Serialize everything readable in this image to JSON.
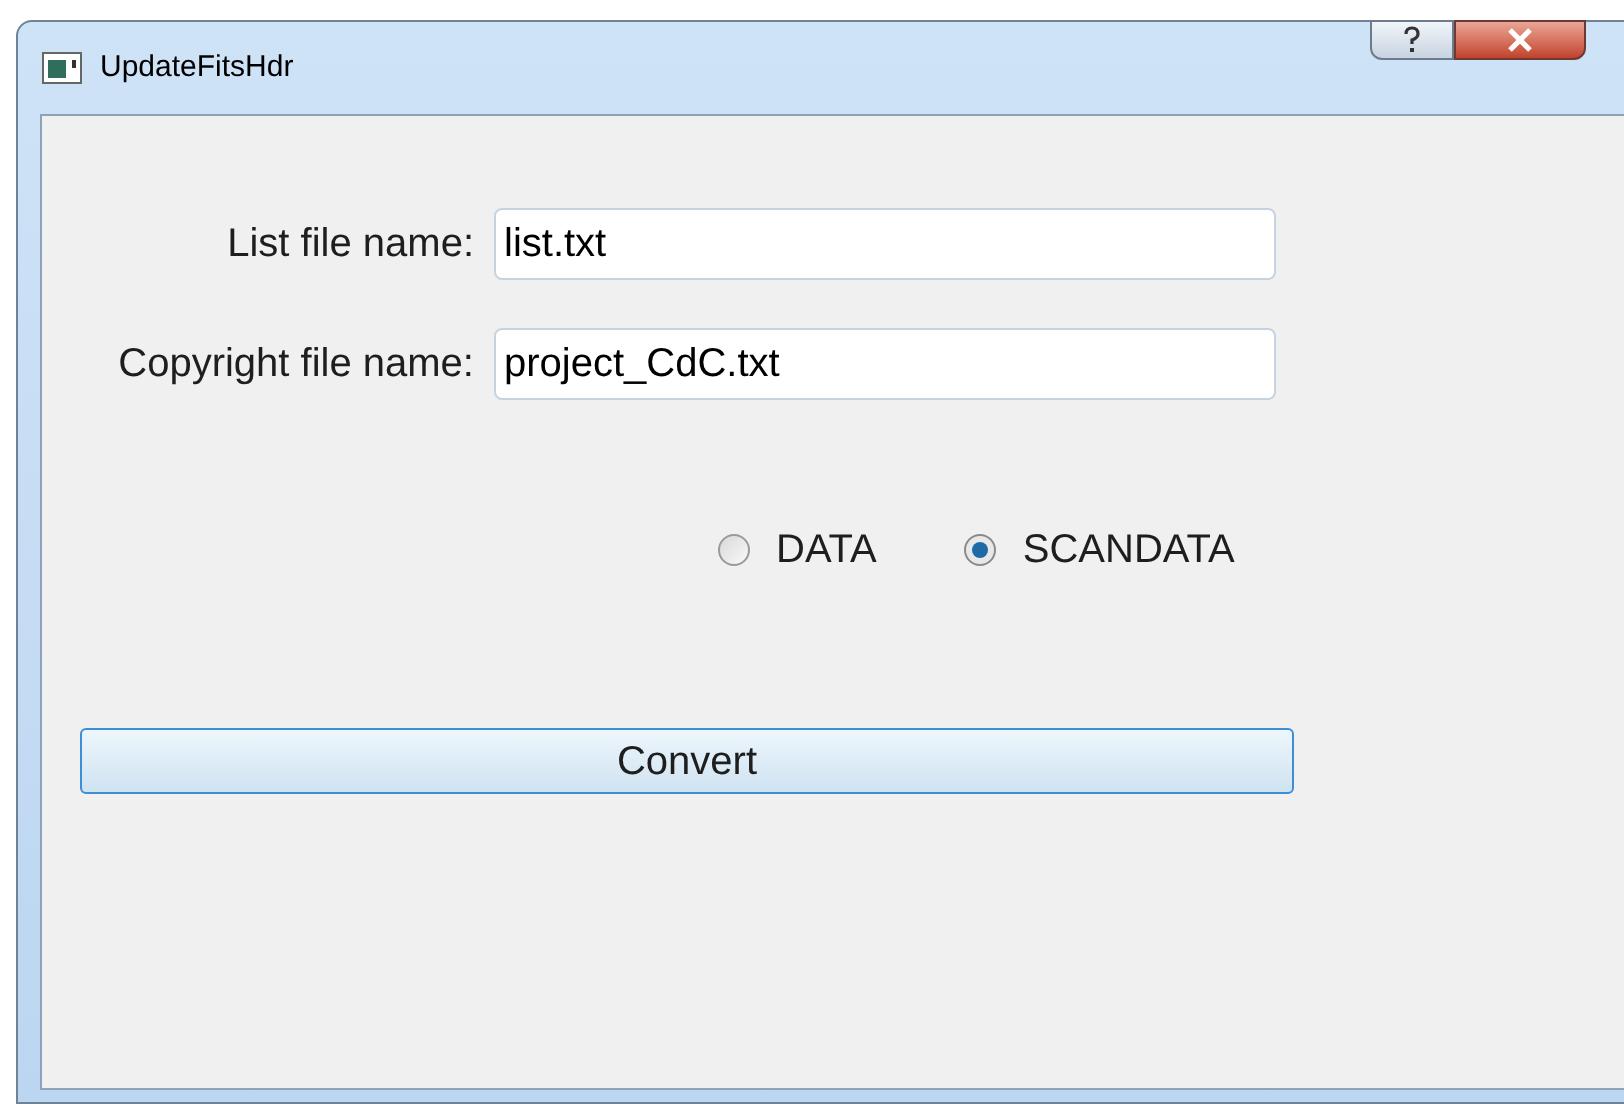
{
  "window": {
    "title": "UpdateFitsHdr"
  },
  "fields": [
    {
      "label": "List file name:",
      "value": "list.txt"
    },
    {
      "label": "Copyright file name:",
      "value": "project_CdC.txt"
    }
  ],
  "radios": [
    {
      "label": "DATA",
      "selected": false
    },
    {
      "label": "SCANDATA",
      "selected": true
    }
  ],
  "buttons": [
    {
      "label": "Convert"
    }
  ]
}
